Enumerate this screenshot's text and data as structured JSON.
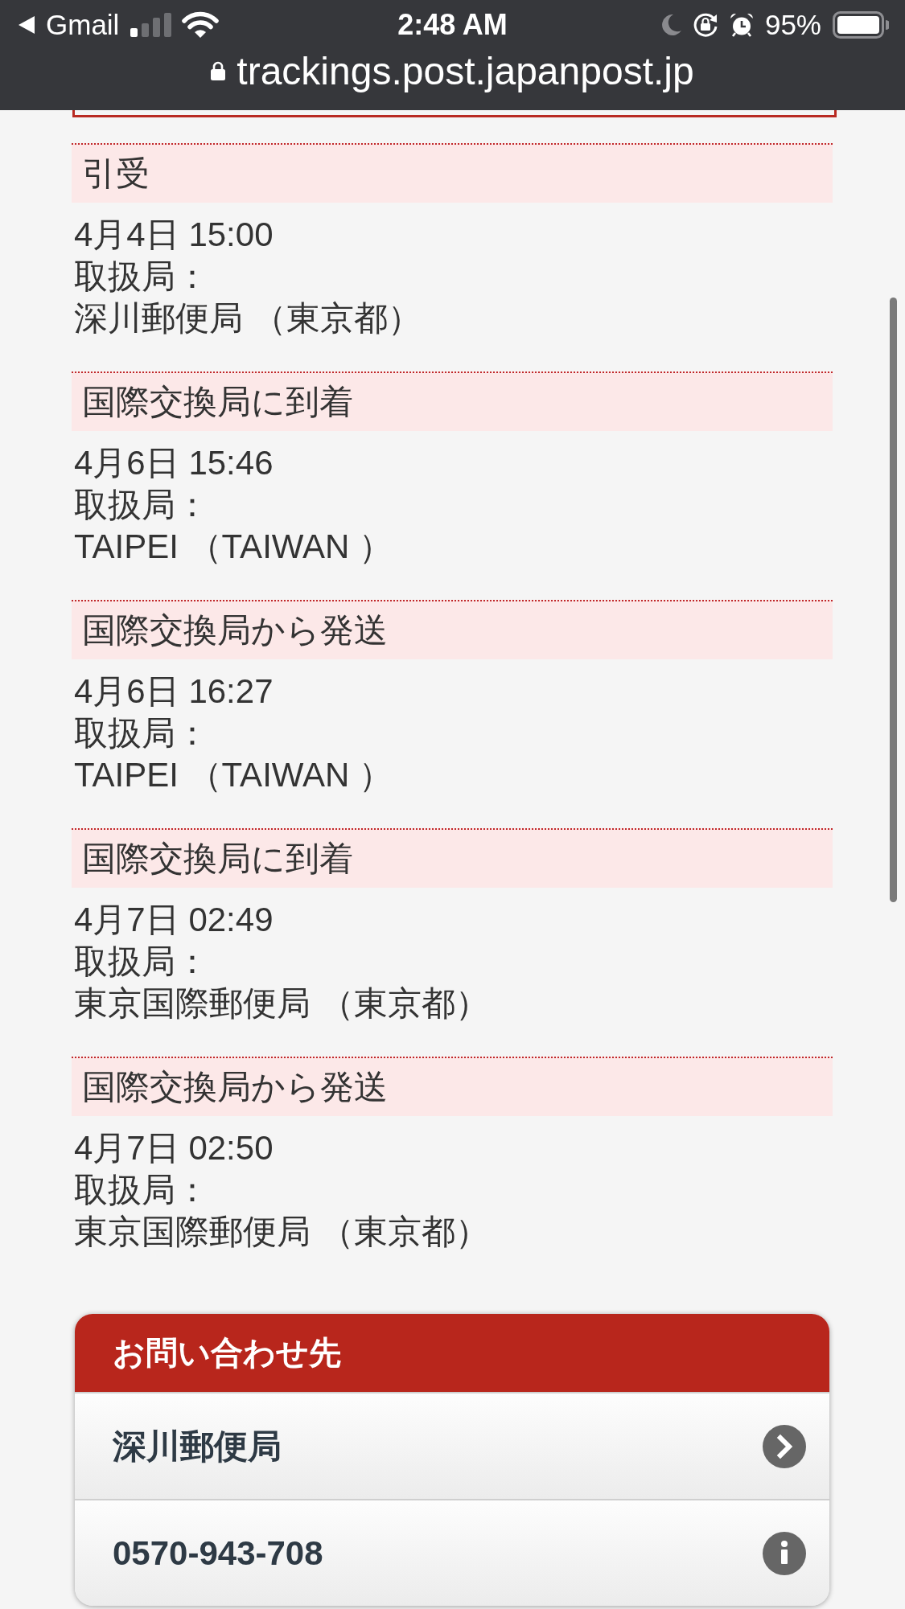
{
  "status_bar": {
    "back_app": "Gmail",
    "time": "2:48 AM",
    "battery": "95%"
  },
  "address_bar": {
    "url": "trackings.post.japanpost.jp"
  },
  "events": [
    {
      "status": "引受",
      "date_time": "4月4日 15:00",
      "office_label": "取扱局：",
      "office": "深川郵便局 （東京都）"
    },
    {
      "status": "国際交換局に到着",
      "date_time": "4月6日 15:46",
      "office_label": "取扱局：",
      "office": "TAIPEI （TAIWAN ）"
    },
    {
      "status": "国際交換局から発送",
      "date_time": "4月6日 16:27",
      "office_label": "取扱局：",
      "office": "TAIPEI （TAIWAN ）"
    },
    {
      "status": "国際交換局に到着",
      "date_time": "4月7日 02:49",
      "office_label": "取扱局：",
      "office": "東京国際郵便局 （東京都）"
    },
    {
      "status": "国際交換局から発送",
      "date_time": "4月7日 02:50",
      "office_label": "取扱局：",
      "office": "東京国際郵便局 （東京都）"
    }
  ],
  "contact": {
    "title": "お問い合わせ先",
    "items": [
      {
        "kind": "link",
        "label": "深川郵便局"
      },
      {
        "kind": "info",
        "label": "0570-943-708"
      }
    ]
  }
}
